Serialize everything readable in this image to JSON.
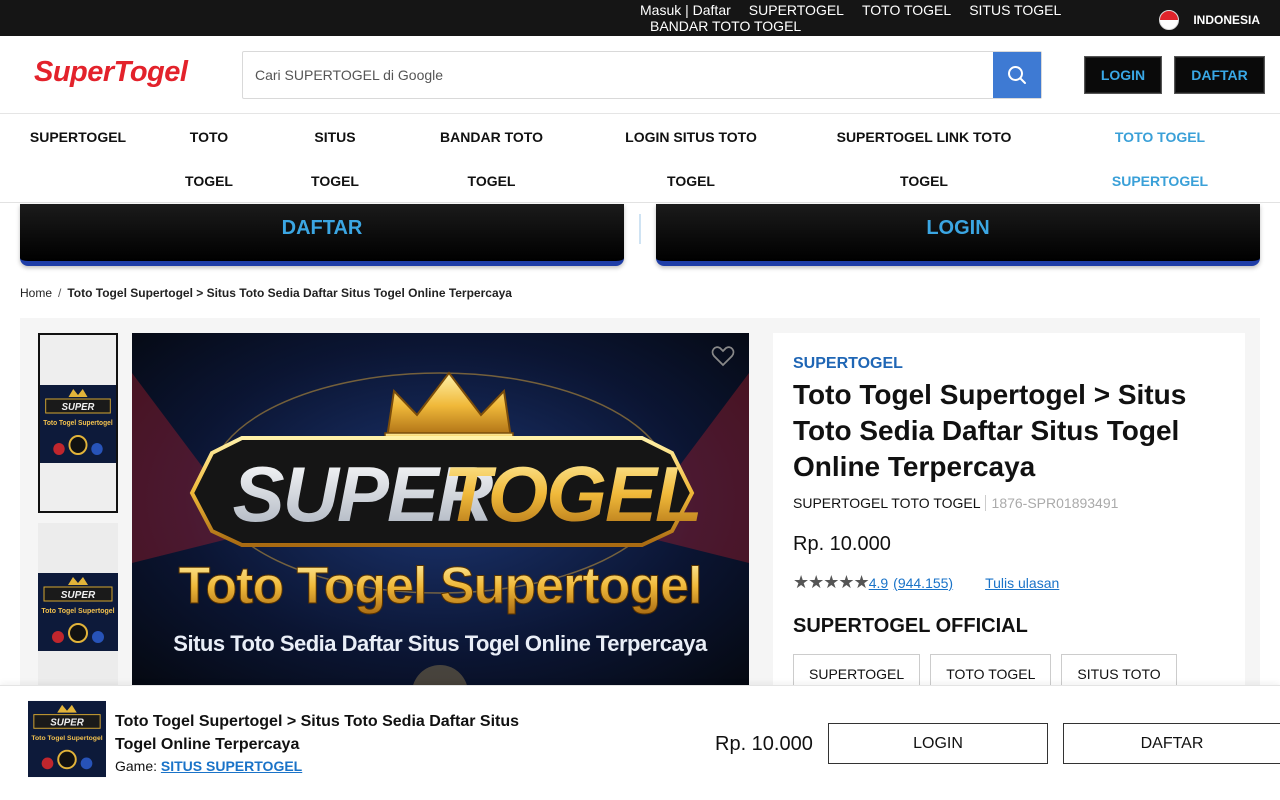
{
  "topbar": {
    "links_line1": [
      "Masuk | Daftar",
      "SUPERTOGEL",
      "TOTO TOGEL",
      "SITUS TOGEL"
    ],
    "links_line2": [
      "BANDAR TOTO TOGEL"
    ],
    "language": "INDONESIA"
  },
  "header": {
    "logo": "SuperTogel",
    "search_placeholder": "Cari SUPERTOGEL di Google",
    "login_label": "LOGIN",
    "daftar_label": "DAFTAR"
  },
  "nav": {
    "items": [
      {
        "line1": "SUPERTOGEL",
        "line2": ""
      },
      {
        "line1": "TOTO",
        "line2": "TOGEL"
      },
      {
        "line1": "SITUS",
        "line2": "TOGEL"
      },
      {
        "line1": "BANDAR TOTO",
        "line2": "TOGEL"
      },
      {
        "line1": "LOGIN SITUS TOTO",
        "line2": "TOGEL"
      },
      {
        "line1": "SUPERTOGEL LINK TOTO",
        "line2": "TOGEL"
      },
      {
        "line1": "TOTO TOGEL",
        "line2": "SUPERTOGEL"
      }
    ]
  },
  "banner_buttons": {
    "daftar": "DAFTAR",
    "login": "LOGIN"
  },
  "breadcrumb": {
    "home": "Home",
    "separator": "/",
    "current": "Toto Togel Supertogel > Situs Toto Sedia Daftar Situs Togel Online Terpercaya"
  },
  "product_image": {
    "brand_word_1": "SUPER",
    "brand_word_2": "TOGEL",
    "headline": "Toto Togel Supertogel",
    "subline": "Situs Toto Sedia Daftar Situs Togel Online Terpercaya"
  },
  "product": {
    "brand": "SUPERTOGEL",
    "title": "Toto Togel Supertogel > Situs Toto Sedia Daftar Situs Togel Online Terpercaya",
    "seller": "SUPERTOGEL TOTO TOGEL",
    "sku": "1876-SPR01893491",
    "price": "Rp. 10.000",
    "stars": "★★★★★",
    "rating": "4.9",
    "reviews": "(944.155)",
    "write_review": "Tulis ulasan",
    "official_heading": "SUPERTOGEL OFFICIAL",
    "tags": [
      "SUPERTOGEL",
      "TOTO TOGEL",
      "SITUS TOTO"
    ]
  },
  "sticky": {
    "title": "Toto Togel Supertogel > Situs Toto Sedia Daftar Situs Togel Online Terpercaya",
    "game_label": "Game:",
    "game_link": "SITUS SUPERTOGEL",
    "price": "Rp. 10.000",
    "login": "LOGIN",
    "daftar": "DAFTAR"
  },
  "colors": {
    "accent_blue": "#3ba6e3",
    "brand_red": "#e3222b",
    "link_blue": "#1a73c8",
    "search_button": "#3e7ad3"
  }
}
